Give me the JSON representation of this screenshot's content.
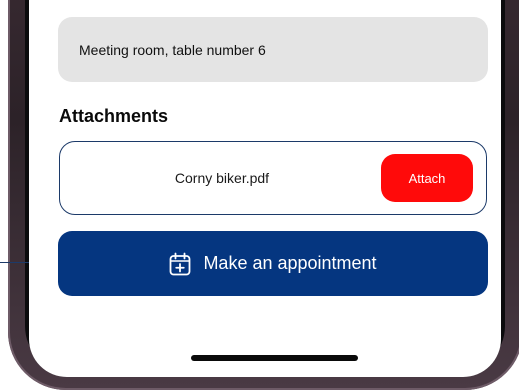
{
  "location": {
    "value": "Meeting room, table number 6"
  },
  "attachments": {
    "heading": "Attachments",
    "file_name": "Corny biker.pdf",
    "attach_label": "Attach"
  },
  "appointment": {
    "label": "Make an appointment",
    "icon": "calendar-plus-icon"
  },
  "colors": {
    "primary_blue": "#053680",
    "attach_red": "#ff0a0a",
    "field_gray": "#e4e4e4"
  }
}
